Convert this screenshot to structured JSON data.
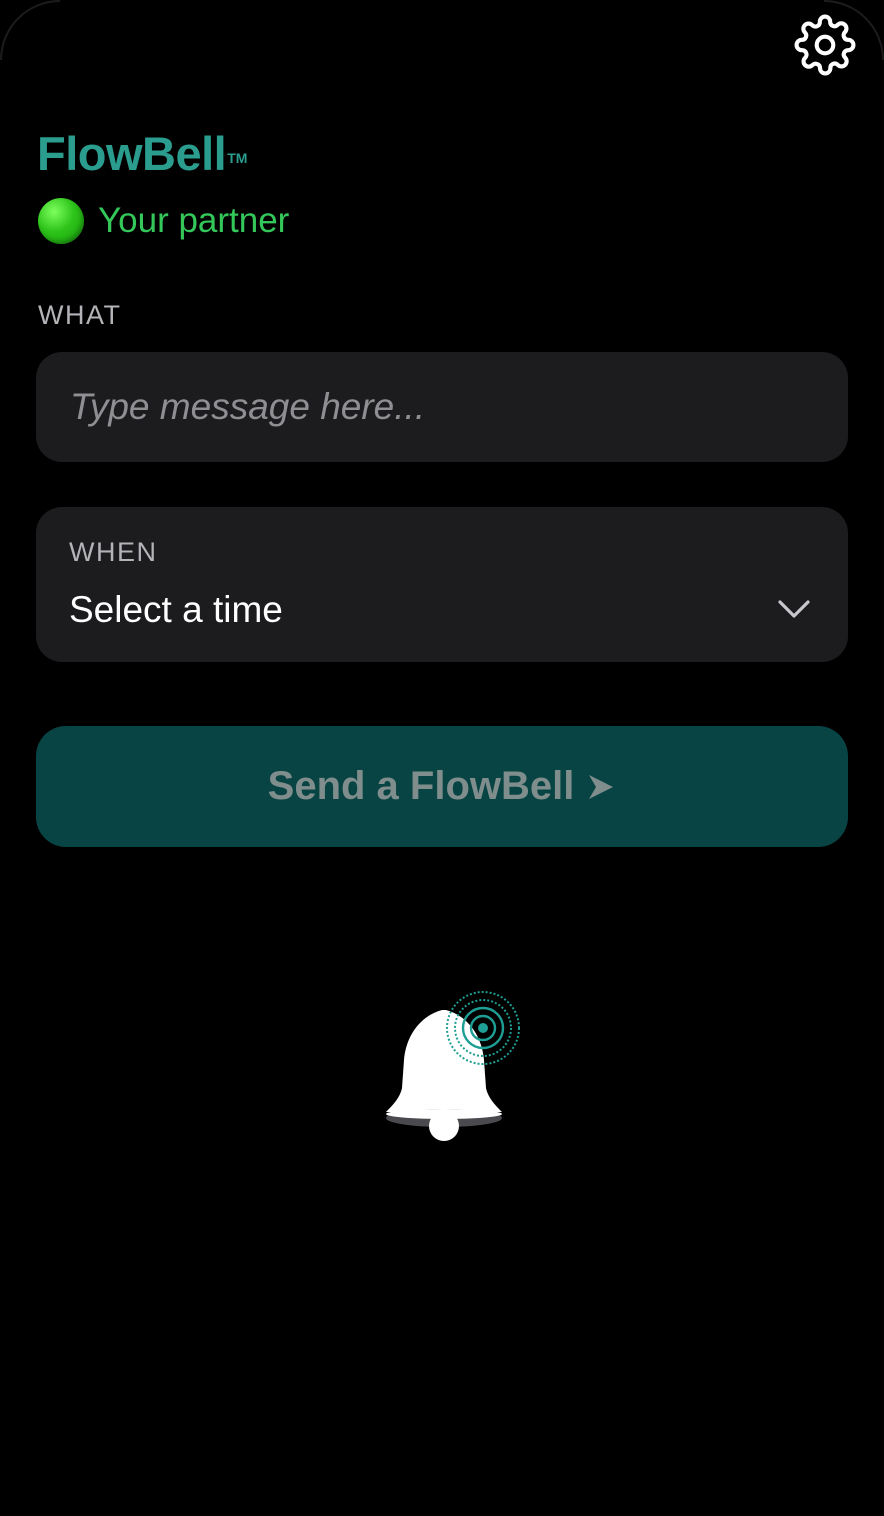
{
  "app": {
    "name": "FlowBell",
    "trademark": "TM",
    "brand_color": "#2a9d8f"
  },
  "status": {
    "label": "Your partner",
    "color": "#34c759",
    "indicator": "online"
  },
  "form": {
    "what": {
      "label": "WHAT",
      "value": "",
      "placeholder": "Type message here..."
    },
    "when": {
      "label": "WHEN",
      "selected": "Select a time"
    },
    "send": {
      "label": "Send a FlowBell",
      "background": "#074443"
    }
  },
  "icons": {
    "settings": "gear-icon",
    "status": "green-circle-icon",
    "dropdown": "chevron-down-icon",
    "send": "arrow-right-icon",
    "illustration": "bell-icon",
    "signal": "ripple-icon"
  },
  "colors": {
    "background": "#000000",
    "card": "#1c1c1e",
    "accent": "#1e9e95"
  }
}
